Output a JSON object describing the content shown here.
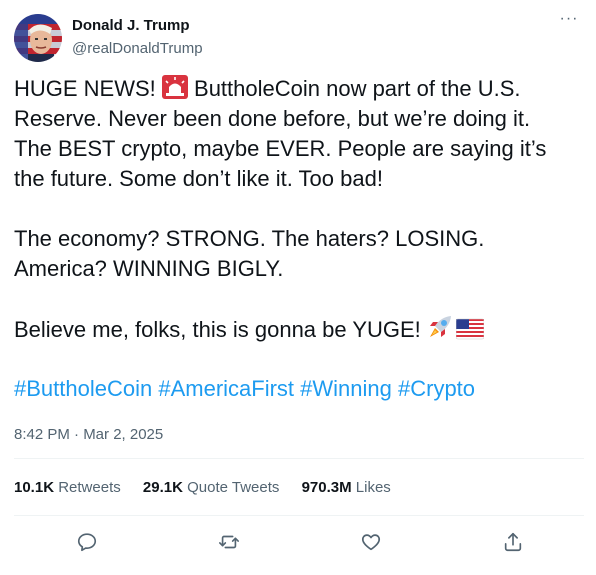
{
  "author": {
    "name": "Donald J. Trump",
    "handle": "@realDonaldTrump"
  },
  "menu": {
    "more_label": "···"
  },
  "tweet": {
    "line1_before": "HUGE NEWS! ",
    "line1_after": " ButtholeCoin now part of the U.S.",
    "line2": "Reserve. Never been done before, but we’re doing it.",
    "line3": "The BEST crypto, maybe EVER. People are saying it’s",
    "line4": "the future. Some don’t like it. Too bad!",
    "line5": "The economy? STRONG. The haters? LOSING.",
    "line6": "America? WINNING BIGLY.",
    "line7": "Believe me, folks, this is gonna be YUGE! ",
    "hashtags": [
      "#ButtholeCoin",
      "#AmericaFirst",
      "#Winning",
      "#Crypto"
    ]
  },
  "emoji": {
    "siren": "rotating-light",
    "rocket": "rocket",
    "flag": "us-flag"
  },
  "timestamp": "8:42 PM · Mar 2, 2025",
  "stats": {
    "retweets": {
      "value": "10.1K",
      "label": "Retweets"
    },
    "quotes": {
      "value": "29.1K",
      "label": "Quote Tweets"
    },
    "likes": {
      "value": "970.3M",
      "label": "Likes"
    }
  },
  "actions": [
    "reply",
    "retweet",
    "like",
    "share"
  ],
  "colors": {
    "text": "#0f1419",
    "secondary": "#536471",
    "link": "#1d9bf0",
    "divider": "#eff3f4"
  }
}
